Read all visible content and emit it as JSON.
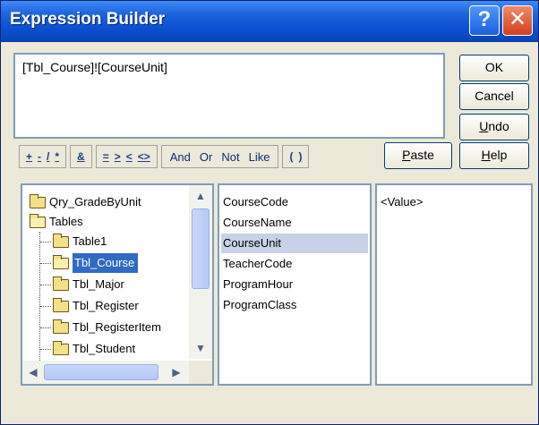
{
  "window": {
    "title": "Expression Builder",
    "help_glyph": "?",
    "close_glyph": "✕"
  },
  "expression": {
    "value": "[Tbl_Course]![CourseUnit]"
  },
  "buttons": {
    "ok": "OK",
    "cancel": "Cancel",
    "undo_u": "U",
    "undo_rest": "ndo",
    "paste_u": "P",
    "paste_rest": "aste",
    "help_u": "H",
    "help_rest": "elp"
  },
  "operators": {
    "arith": [
      "+",
      "-",
      "/",
      "*"
    ],
    "concat": [
      "&"
    ],
    "compare": [
      "=",
      ">",
      "<",
      "<>"
    ],
    "logic": [
      "And",
      "Or",
      "Not",
      "Like"
    ],
    "paren": [
      "(",
      ")"
    ]
  },
  "tree": {
    "items": [
      {
        "label": "Qry_GradeByUnit"
      },
      {
        "label": "Tables"
      },
      {
        "label": "Table1"
      },
      {
        "label": "Tbl_Course"
      },
      {
        "label": "Tbl_Major"
      },
      {
        "label": "Tbl_Register"
      },
      {
        "label": "Tbl_RegisterItem"
      },
      {
        "label": "Tbl_Student"
      }
    ],
    "selected": "Tbl_Course"
  },
  "fields": {
    "items": [
      "CourseCode",
      "CourseName",
      "CourseUnit",
      "TeacherCode",
      "ProgramHour",
      "ProgramClass"
    ],
    "selected": "CourseUnit"
  },
  "values": {
    "items": [
      "<Value>"
    ]
  },
  "scroll": {
    "up": "▲",
    "down": "▼",
    "left": "◀",
    "right": "▶"
  },
  "colors": {
    "title_bar": "#0a4fd1",
    "selection": "#316ac5",
    "operator_text": "#1b3e8c"
  }
}
